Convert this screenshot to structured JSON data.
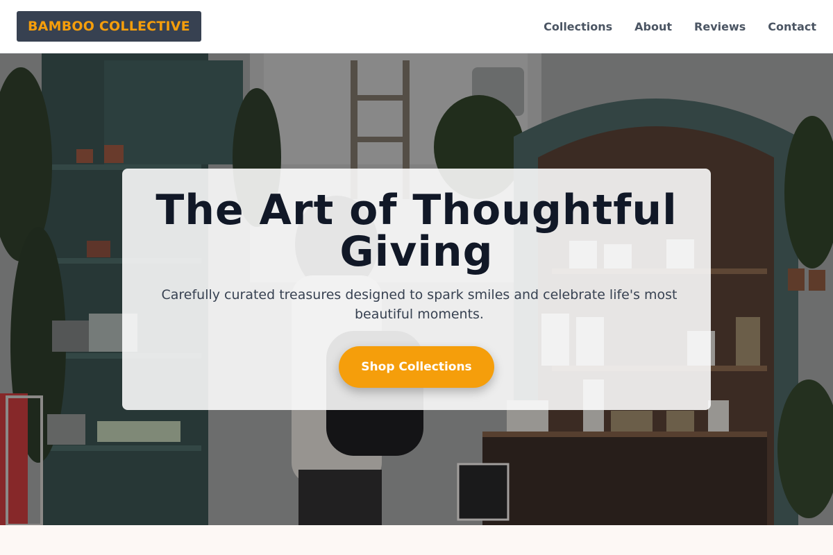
{
  "header": {
    "logo_text": "BAMBOO COLLECTIVE",
    "nav": [
      {
        "label": "Collections"
      },
      {
        "label": "About"
      },
      {
        "label": "Reviews"
      },
      {
        "label": "Contact"
      }
    ]
  },
  "hero": {
    "background_image": "gift-shop-interior-photo",
    "title": "The Art of Thoughtful Giving",
    "subtitle": "Carefully curated treasures designed to spark smiles and celebrate life's most beautiful moments.",
    "cta_label": "Shop Collections"
  },
  "colors": {
    "accent": "#f59e0b",
    "logo_bg": "#374151",
    "title": "#111827",
    "nav_text": "#4b5563",
    "page_bg": "#fdf8f5"
  }
}
